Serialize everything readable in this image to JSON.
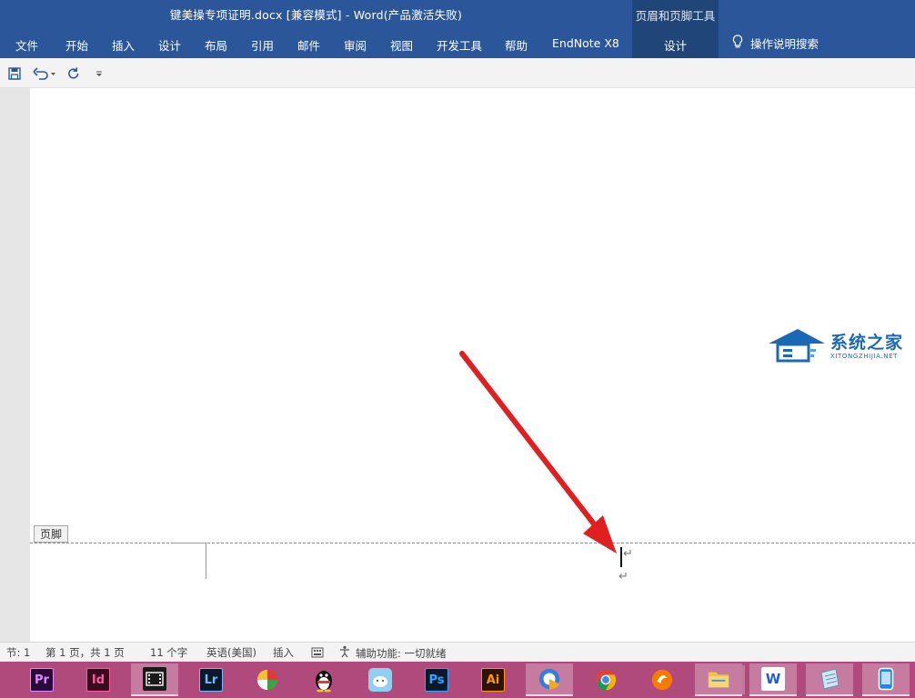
{
  "window": {
    "title": "键美操专项证明.docx [兼容模式] - Word(产品激活失败)",
    "context_group_title": "页眉和页脚工具"
  },
  "ribbon": {
    "tabs": [
      "文件",
      "开始",
      "插入",
      "设计",
      "布局",
      "引用",
      "邮件",
      "审阅",
      "视图",
      "开发工具",
      "帮助",
      "EndNote X8"
    ],
    "context_tab": "设计",
    "tell_me": "操作说明搜索"
  },
  "quick_access": {
    "icons": [
      "save-icon",
      "undo-icon",
      "redo-icon",
      "customize-icon"
    ]
  },
  "document": {
    "footer_label": "页脚",
    "paragraph_mark": "↵"
  },
  "watermark": {
    "name": "系统之家",
    "site": "XITONGZHIJIA.NET"
  },
  "status_bar": {
    "section": "节: 1",
    "page": "第 1 页，共 1 页",
    "words": "11 个字",
    "language": "英语(美国)",
    "mode": "插入",
    "accessibility": "辅助功能: 一切就绪"
  },
  "taskbar": {
    "apps": [
      {
        "name": "premiere",
        "label": "Pr",
        "bg": "#2a0a3a",
        "fg": "#e08cff"
      },
      {
        "name": "indesign",
        "label": "Id",
        "bg": "#3a0a1e",
        "fg": "#ff5aa0"
      },
      {
        "name": "video-editor",
        "label": "",
        "bg": "#1a1a1a",
        "fg": "#ffffff"
      },
      {
        "name": "lightroom",
        "label": "Lr",
        "bg": "#0a1a2a",
        "fg": "#7ab8ff"
      },
      {
        "name": "app-pinwheel",
        "label": "",
        "bg": "",
        "fg": ""
      },
      {
        "name": "qq",
        "label": "",
        "bg": "",
        "fg": ""
      },
      {
        "name": "app-cloud",
        "label": "",
        "bg": "",
        "fg": ""
      },
      {
        "name": "photoshop",
        "label": "Ps",
        "bg": "#0a1a2e",
        "fg": "#31a8ff"
      },
      {
        "name": "illustrator",
        "label": "Ai",
        "bg": "#2e1400",
        "fg": "#ff9a00"
      },
      {
        "name": "browser",
        "label": "",
        "bg": "",
        "fg": ""
      },
      {
        "name": "chrome",
        "label": "",
        "bg": "",
        "fg": ""
      },
      {
        "name": "app-orange",
        "label": "",
        "bg": "",
        "fg": ""
      },
      {
        "name": "file-explorer",
        "label": "",
        "bg": "",
        "fg": ""
      },
      {
        "name": "wps",
        "label": "W",
        "bg": "#ffffff",
        "fg": "#1e5bd8"
      },
      {
        "name": "notepad",
        "label": "",
        "bg": "",
        "fg": ""
      },
      {
        "name": "phone",
        "label": "",
        "bg": "",
        "fg": ""
      }
    ]
  },
  "colors": {
    "ribbon": "#2b579a",
    "context_group": "#204578",
    "taskbar": "#b04a7d",
    "arrow": "#e02020"
  }
}
